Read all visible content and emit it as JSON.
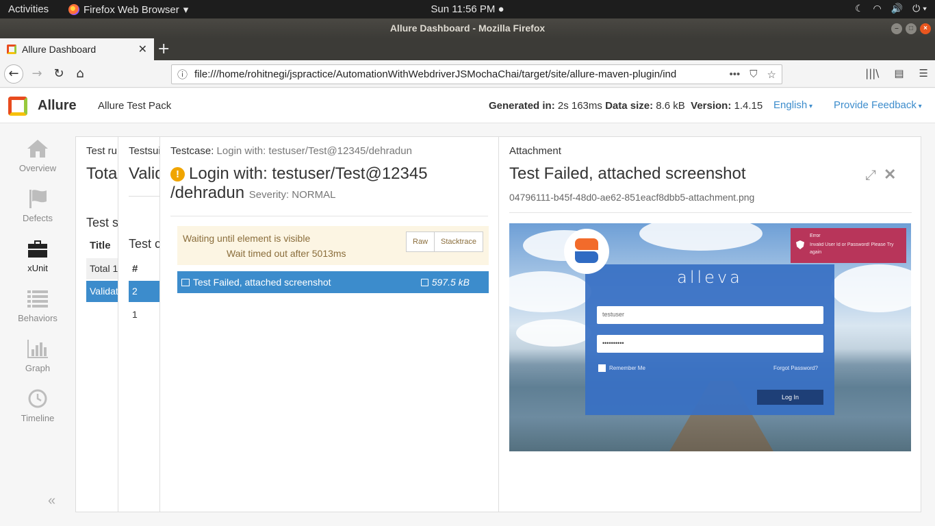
{
  "system_bar": {
    "activities": "Activities",
    "app_name": "Firefox Web Browser",
    "clock": "Sun 11:56 PM"
  },
  "window": {
    "title": "Allure Dashboard - Mozilla Firefox"
  },
  "browser": {
    "tab_title": "Allure Dashboard",
    "url": "file:///home/rohitnegi/jspractice/AutomationWithWebdriverJSMochaChai/target/site/allure-maven-plugin/ind",
    "url_more": "•••"
  },
  "allure_header": {
    "brand": "Allure",
    "pack": "Allure Test Pack",
    "generated_label": "Generated in:",
    "generated_value": "2s 163ms",
    "size_label": "Data size:",
    "size_value": "8.6 kB",
    "version_label": "Version:",
    "version_value": "1.4.15",
    "language": "English",
    "feedback": "Provide Feedback"
  },
  "sidenav": {
    "items": [
      {
        "label": "Overview",
        "icon": "home-icon",
        "active": false
      },
      {
        "label": "Defects",
        "icon": "flag-icon",
        "active": false
      },
      {
        "label": "xUnit",
        "icon": "briefcase-icon",
        "active": true
      },
      {
        "label": "Behaviors",
        "icon": "list-icon",
        "active": false
      },
      {
        "label": "Graph",
        "icon": "bar-chart-icon",
        "active": false
      },
      {
        "label": "Timeline",
        "icon": "clock-icon",
        "active": false
      }
    ],
    "collapse": "«"
  },
  "test_run_pane": {
    "label": "Test ru",
    "title": "Tota",
    "subtitle": "Test s",
    "column_title": "Title",
    "rows": [
      "Total 1",
      "Validat"
    ]
  },
  "testsuite_pane": {
    "label": "Testsui",
    "title": "Valid",
    "subtitle": "Test c",
    "column_num": "#",
    "rows": [
      "2",
      "1"
    ]
  },
  "testcase_pane": {
    "label": "Testcase:",
    "label_value": "Login with: testuser/Test@12345/dehradun",
    "title_line1": "Login with: testuser/Test@12345",
    "title_line2": "/dehradun",
    "severity": "Severity: NORMAL",
    "message_line1": "Waiting until element is visible",
    "message_line2": "Wait timed out after 5013ms",
    "raw_button": "Raw",
    "stacktrace_button": "Stacktrace",
    "attachment_name": "Test Failed, attached screenshot",
    "attachment_size": "597.5 kB"
  },
  "attachment_pane": {
    "label": "Attachment",
    "title": "Test Failed, attached screenshot",
    "filename": "04796111-b45f-48d0-ae62-851eacf8dbb5-attachment.png",
    "screenshot": {
      "app_name": "alleva",
      "username_value": "testuser",
      "password_value": "••••••••••",
      "remember_me": "Remember Me",
      "forgot_password": "Forgot Password?",
      "login_button": "Log In",
      "error_title": "Error",
      "error_message": "Invalid User Id or Password! Please Try again"
    }
  }
}
